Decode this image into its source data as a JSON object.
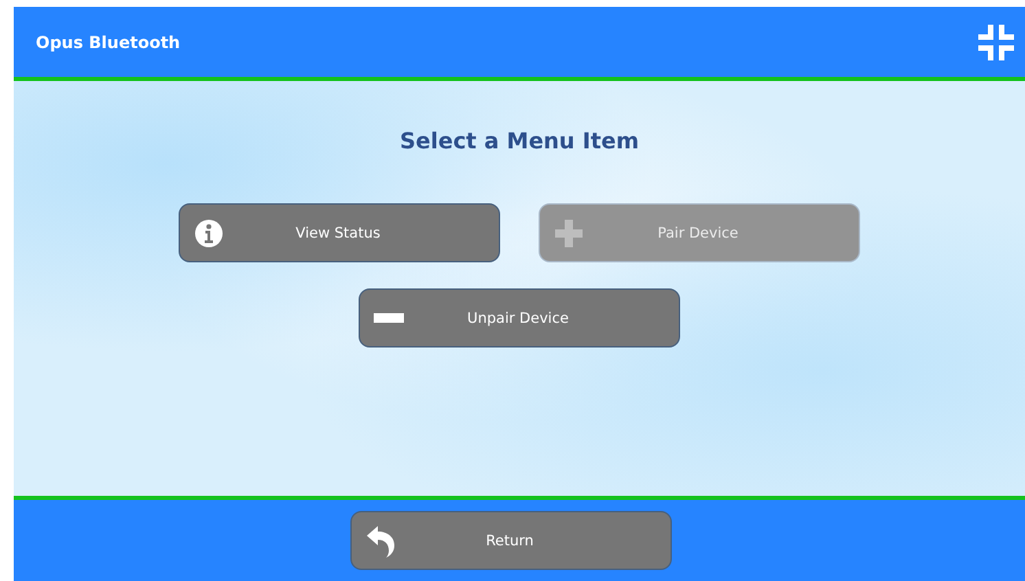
{
  "header": {
    "title": "Opus Bluetooth"
  },
  "heading": "Select a Menu Item",
  "menu_items": [
    {
      "label": "View Status",
      "kind": "info",
      "disabled": false
    },
    {
      "label": "Pair Device",
      "kind": "plus",
      "disabled": true
    },
    {
      "label": "Unpair Device",
      "kind": "minus",
      "disabled": false
    }
  ],
  "footer": {
    "return_button": {
      "label": "Return",
      "kind": "return",
      "disabled": false
    }
  }
}
